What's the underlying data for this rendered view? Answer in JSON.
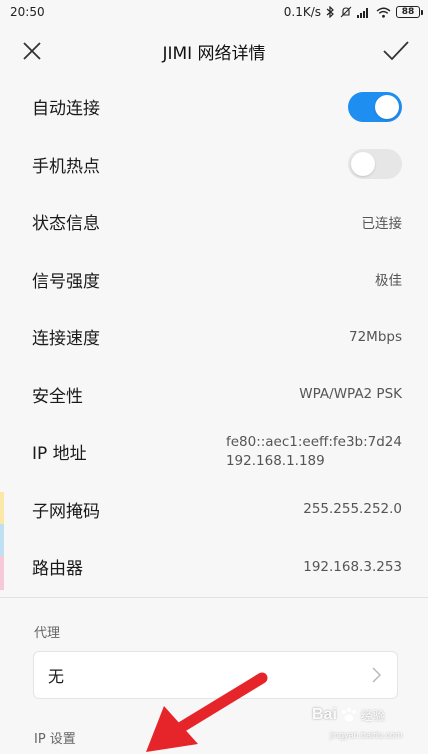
{
  "status_bar": {
    "time": "20:50",
    "speed": "0.1K/s",
    "battery": "88"
  },
  "header": {
    "title": "JIMI 网络详情"
  },
  "rows": [
    {
      "label": "自动连接",
      "type": "toggle",
      "on": true
    },
    {
      "label": "手机热点",
      "type": "toggle",
      "on": false
    },
    {
      "label": "状态信息",
      "value": "已连接"
    },
    {
      "label": "信号强度",
      "value": "极佳"
    },
    {
      "label": "连接速度",
      "value": "72Mbps"
    },
    {
      "label": "安全性",
      "value": "WPA/WPA2 PSK"
    },
    {
      "label": "IP 地址",
      "value_lines": [
        "fe80::aec1:eeff:fe3b:7d24",
        "192.168.1.189"
      ]
    },
    {
      "label": "子网掩码",
      "value": "255.255.252.0"
    },
    {
      "label": "路由器",
      "value": "192.168.3.253"
    }
  ],
  "proxy": {
    "section_label": "代理",
    "value": "无"
  },
  "ip_settings": {
    "section_label": "IP 设置"
  },
  "watermark": {
    "brand": "Bai",
    "sub": "经验",
    "url": "jingyan.baidu.com"
  },
  "colors": {
    "accent": "#1f8ef1",
    "arrow": "#e5252a"
  }
}
